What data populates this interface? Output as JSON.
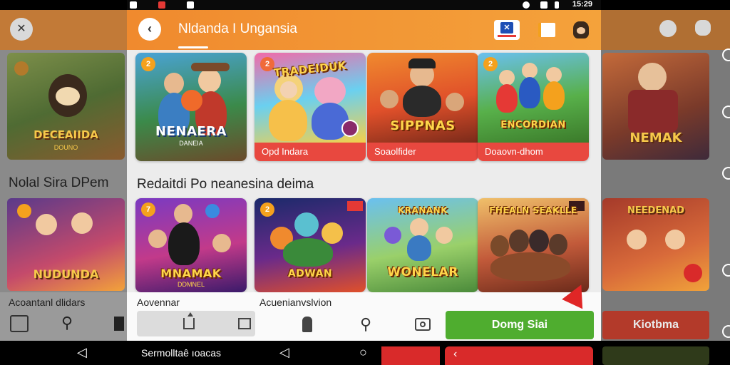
{
  "app": {
    "title": "Nldanda I Ungansia",
    "time": "15:29"
  },
  "cards_top": [
    {
      "badge": "2",
      "banner": "NENAERA",
      "sub": "DANEIA",
      "caption": ""
    },
    {
      "badge": "2",
      "banner": "TRADEIDUK",
      "sub": "",
      "caption": "Opd Indara"
    },
    {
      "badge": "",
      "banner": "SIPPNAS",
      "sub": "",
      "caption": "Soaolfider"
    },
    {
      "badge": "2",
      "banner": "ENCORDIAN",
      "sub": "",
      "caption": "Doaovn-dhom"
    }
  ],
  "section_title": "Redaitdi Po neanesina deima",
  "cards_bottom": [
    {
      "badge": "7",
      "banner": "MNAMAK",
      "sub": "DDMNEL",
      "caption": ""
    },
    {
      "badge": "2",
      "banner": "ADWAN",
      "sub": "",
      "caption": ""
    },
    {
      "badge": "",
      "banner": "WONELAR",
      "sub": "",
      "caption": "",
      "top": "KRANANK"
    },
    {
      "badge": "",
      "banner": "",
      "sub": "",
      "caption": "",
      "top": "FHEALN SEAKLLE"
    }
  ],
  "bottom_sheet": {
    "label_left": "Aovennar",
    "label_right": "Acuenianvslvion",
    "cta": "Domg Siai"
  },
  "navbar": {
    "text": "Sermolltaê ıoacas",
    "back": "◁",
    "home": "○"
  },
  "side_left": {
    "card1_banner": "DECEAIIDA",
    "card1_sub": "DOUNO",
    "heading": "Nolal Sira DPem",
    "card2_banner": "NUDUNDA",
    "bottom_label": "Acoantanl dlidars"
  },
  "side_right": {
    "card1_banner": "NEMAK",
    "card2_banner": "NEEDENAD",
    "bottom_button": "Kiotbma"
  },
  "colors": {
    "appbar": "#f08a2e",
    "caption_red": "#e8483f",
    "cta_green": "#4fad2f",
    "badge_orange": "#f4a11d"
  }
}
